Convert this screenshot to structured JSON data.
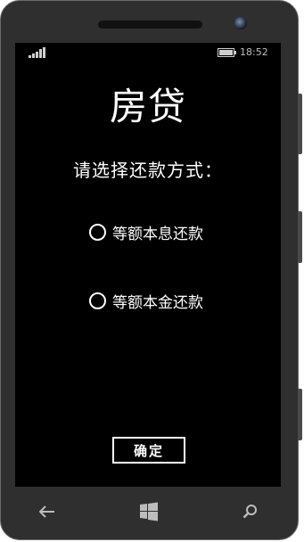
{
  "status": {
    "time": "18:52",
    "icons": [
      "signal-icon",
      "battery-icon"
    ]
  },
  "app": {
    "title": "房贷",
    "prompt": "请选择还款方式：",
    "options": [
      {
        "label": "等额本息还款",
        "selected": false
      },
      {
        "label": "等额本金还款",
        "selected": false
      }
    ],
    "confirm_label": "确定"
  },
  "navbar": {
    "icons": [
      "back-icon",
      "windows-start-icon",
      "search-icon"
    ]
  },
  "colors": {
    "screen_background": "#000000",
    "foreground": "#ffffff",
    "phone_body": "#2f2f2f"
  }
}
